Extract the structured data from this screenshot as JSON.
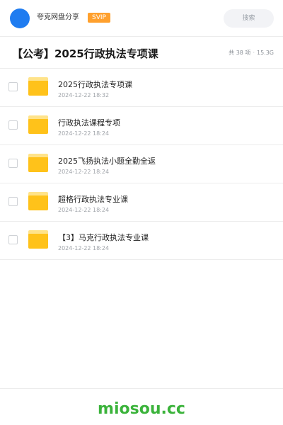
{
  "header": {
    "account_name": "夸克网盘分享",
    "badge": "SVIP",
    "search_placeholder": "搜索",
    "avatar_color": "#1f7cf0",
    "badge_color": "#ffa02d"
  },
  "folder": {
    "title": "【公考】2025行政执法专项课",
    "count": "共 38 项",
    "separator": "·",
    "size": "15.3G"
  },
  "items": [
    {
      "name": "2025行政执法专项课",
      "date": "2024-12-22 18:32",
      "icon": "folder-icon"
    },
    {
      "name": "行政执法课程专项",
      "date": "2024-12-22 18:24",
      "icon": "folder-icon"
    },
    {
      "name": "2025飞扬执法小题全勤全返",
      "date": "2024-12-22 18:24",
      "icon": "folder-icon"
    },
    {
      "name": "超格行政执法专业课",
      "date": "2024-12-22 18:24",
      "icon": "folder-icon"
    },
    {
      "name": "【3】马克行政执法专业课",
      "date": "2024-12-22 18:24",
      "icon": "folder-icon"
    }
  ],
  "footer": {
    "watermark": "miosou.cc",
    "watermark_color": "#3bb33b"
  }
}
